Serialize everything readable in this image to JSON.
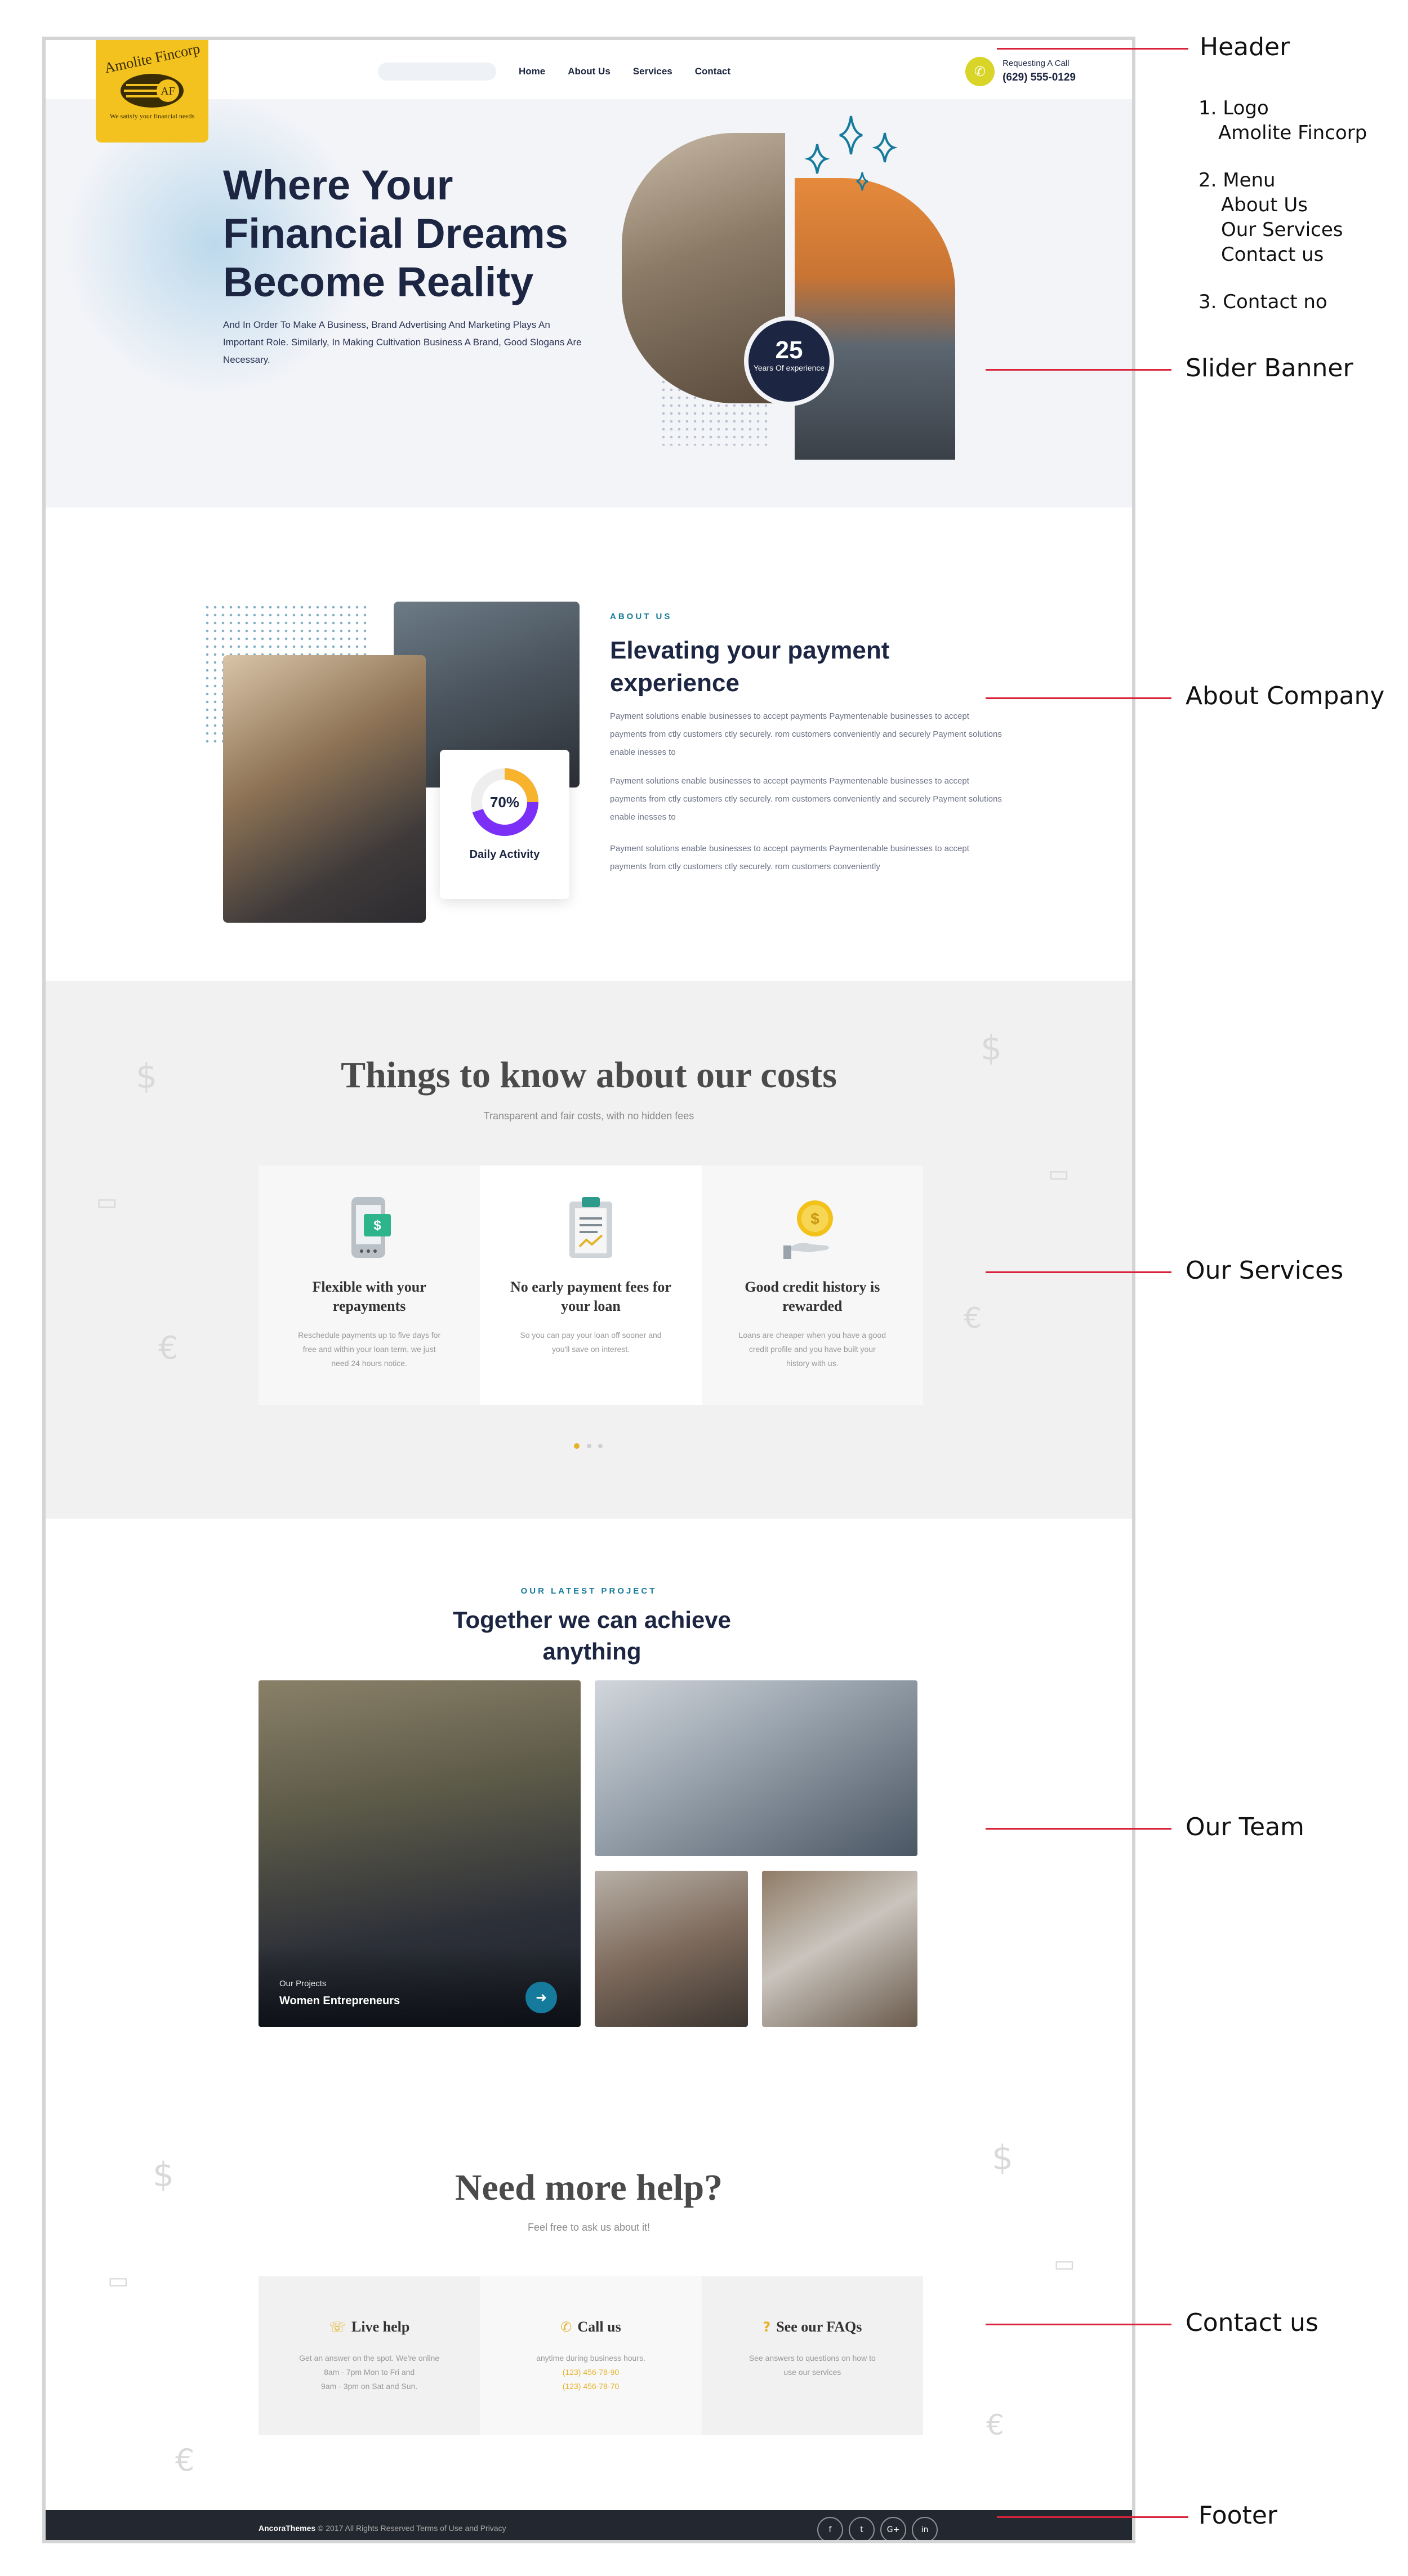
{
  "header": {
    "logo_name": "Amolite Fincorp",
    "logo_initials": "AF",
    "logo_tagline": "We satisfy your financial needs",
    "nav": [
      "Home",
      "About Us",
      "Services",
      "Contact"
    ],
    "call_label": "Requesting A Call",
    "call_number": "(629) 555-0129",
    "brand_color": "#f3c21e"
  },
  "hero": {
    "title": "Where Your Financial Dreams Become Reality",
    "text": "And In Order To Make A Business, Brand Advertising And Marketing Plays An Important Role. Similarly, In Making Cultivation Business A Brand, Good Slogans Are Necessary.",
    "badge_number": "25",
    "badge_label": "Years Of experience"
  },
  "about": {
    "label": "ABOUT US",
    "title": "Elevating your payment experience",
    "paragraphs": [
      "Payment solutions enable businesses to accept payments Paymentenable businesses to accept payments from ctly customers ctly securely. rom customers conveniently and securely Payment solutions enable inesses to",
      "Payment solutions enable businesses to accept payments Paymentenable businesses to accept payments from ctly customers ctly securely. rom customers conveniently and securely Payment solutions enable inesses to",
      "Payment solutions enable businesses to accept payments Paymentenable businesses to accept payments from ctly customers ctly securely. rom customers conveniently"
    ],
    "activity_value": "70%",
    "activity_fraction": 0.7,
    "activity_label": "Daily Activity"
  },
  "services": {
    "title": "Things to know about our costs",
    "subtitle": "Transparent and fair costs, with no hidden fees",
    "cards": [
      {
        "icon": "phone-dollar-icon",
        "title": "Flexible with your repayments",
        "text": "Reschedule payments up to five days for free and within your loan term, we just need 24 hours notice."
      },
      {
        "icon": "clipboard-icon",
        "title": "No early payment fees for your loan",
        "text": "So you can pay your loan off sooner and you'll save on interest."
      },
      {
        "icon": "coin-hand-icon",
        "title": "Good credit history is rewarded",
        "text": "Loans are cheaper when you have a good credit profile and you have built your history with us."
      }
    ]
  },
  "team": {
    "label": "OUR LATEST PROJECT",
    "title": "Together we can achieve anything",
    "project_small": "Our Projects",
    "project_big": "Women Entrepreneurs"
  },
  "help": {
    "title": "Need more help?",
    "subtitle": "Feel free to ask us about it!",
    "cards": [
      {
        "icon": "chat-icon",
        "title": "Live help",
        "lines": [
          "Get an answer on the spot. We're online",
          "8am - 7pm Mon to Fri and",
          "9am - 3pm on Sat and Sun."
        ]
      },
      {
        "icon": "phone-icon",
        "title": "Call us",
        "lines": [
          "anytime during business hours."
        ],
        "phones": [
          "(123) 456-78-90",
          "(123) 456-78-70"
        ]
      },
      {
        "icon": "question-icon",
        "title": "See our FAQs",
        "lines": [
          "See answers to questions on how to",
          "use our services"
        ]
      }
    ]
  },
  "footer": {
    "brand": "AncoraThemes",
    "text": "© 2017 All Rights Reserved Terms of Use and Privacy",
    "socials": [
      "f",
      "t",
      "G+",
      "in"
    ]
  },
  "annotations": {
    "header": "Header",
    "header_list": [
      "1. Logo",
      "Amolite Fincorp",
      "2. Menu",
      "About Us",
      "Our Services",
      "Contact us",
      "3. Contact no"
    ],
    "slider": "Slider Banner",
    "about": "About Company",
    "services": "Our Services",
    "team": "Our Team",
    "contact": "Contact us",
    "footer": "Footer",
    "line_color": "#d9233a"
  }
}
